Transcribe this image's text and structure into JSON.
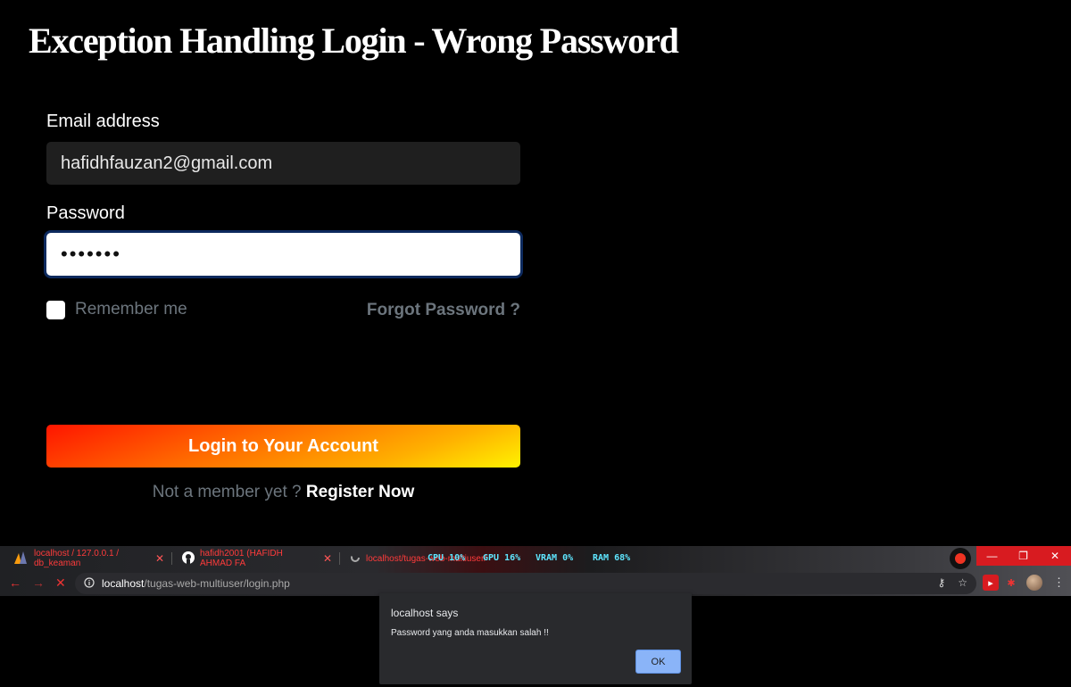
{
  "heading": "Exception Handling Login - Wrong Password",
  "form": {
    "email_label": "Email address",
    "email_value": "hafidhfauzan2@gmail.com",
    "password_label": "Password",
    "password_value": "•••••••",
    "remember_label": "Remember me",
    "forgot_label": "Forgot Password ?",
    "login_button": "Login to Your Account",
    "signup_prompt": "Not a member yet ?",
    "signup_link": "Register Now"
  },
  "browser": {
    "tabs": [
      {
        "title": "localhost / 127.0.0.1 / db_keaman",
        "icon": "phpmyadmin-icon"
      },
      {
        "title": "hafidh2001 (HAFIDH AHMAD FA",
        "icon": "github-icon"
      },
      {
        "title": "localhost/tugas-web-multiuser/",
        "icon": "loading-icon"
      }
    ],
    "perf": {
      "cpu": "CPU  10%",
      "gpu": "GPU  16%",
      "vram": "VRAM   0%",
      "ram": "RAM  68%"
    },
    "url_host": "localhost",
    "url_path": "/tugas-web-multiuser/login.php",
    "window": {
      "minimize": "—",
      "restore": "❐",
      "close": "✕"
    }
  },
  "dialog": {
    "title": "localhost says",
    "message": "Password yang anda masukkan salah !!",
    "ok": "OK"
  }
}
